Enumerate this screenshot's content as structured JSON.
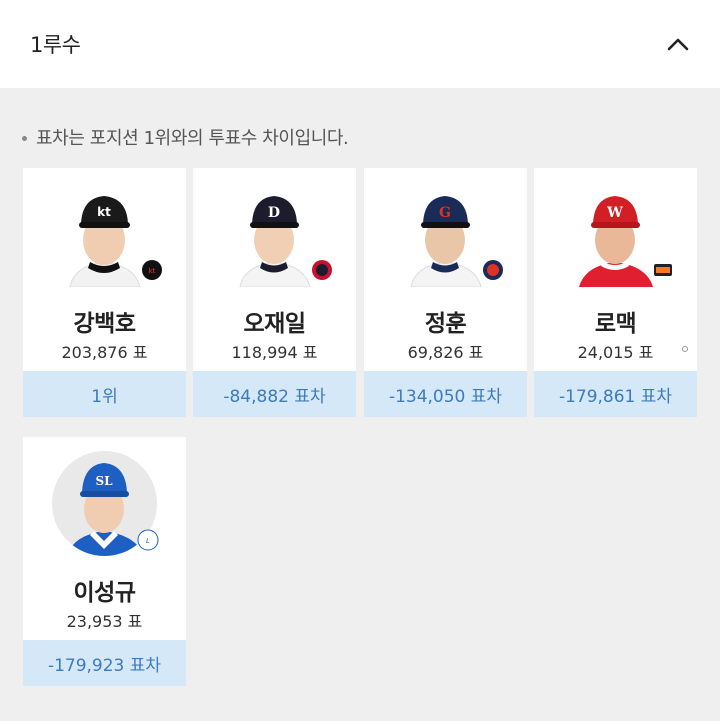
{
  "section": {
    "title": "1루수"
  },
  "notice": "표차는 포지션 1위와의 투표수 차이입니다.",
  "players": [
    {
      "name": "강백호",
      "votes": "203,876 표",
      "gap": "1위",
      "team_color": "#d8232a",
      "cap_color": "#1a1a1a",
      "cap_mark": "kt"
    },
    {
      "name": "오재일",
      "votes": "118,994 표",
      "gap": "-84,882 표차",
      "team_color": "#c8102e",
      "cap_color": "#1c1c2e",
      "cap_mark": "D"
    },
    {
      "name": "정훈",
      "votes": "69,826 표",
      "gap": "-134,050 표차",
      "team_color": "#1a2a5a",
      "cap_color": "#1b2b58",
      "cap_mark": "G"
    },
    {
      "name": "로맥",
      "votes": "24,015 표",
      "gap": "-179,861 표차",
      "team_color": "#ce0e2d",
      "cap_color": "#d21f26",
      "cap_mark": "W"
    },
    {
      "name": "이성규",
      "votes": "23,953 표",
      "gap": "-179,923 표차",
      "team_color": "#1a63c4",
      "cap_color": "#1d5fc2",
      "cap_mark": "SL"
    }
  ]
}
